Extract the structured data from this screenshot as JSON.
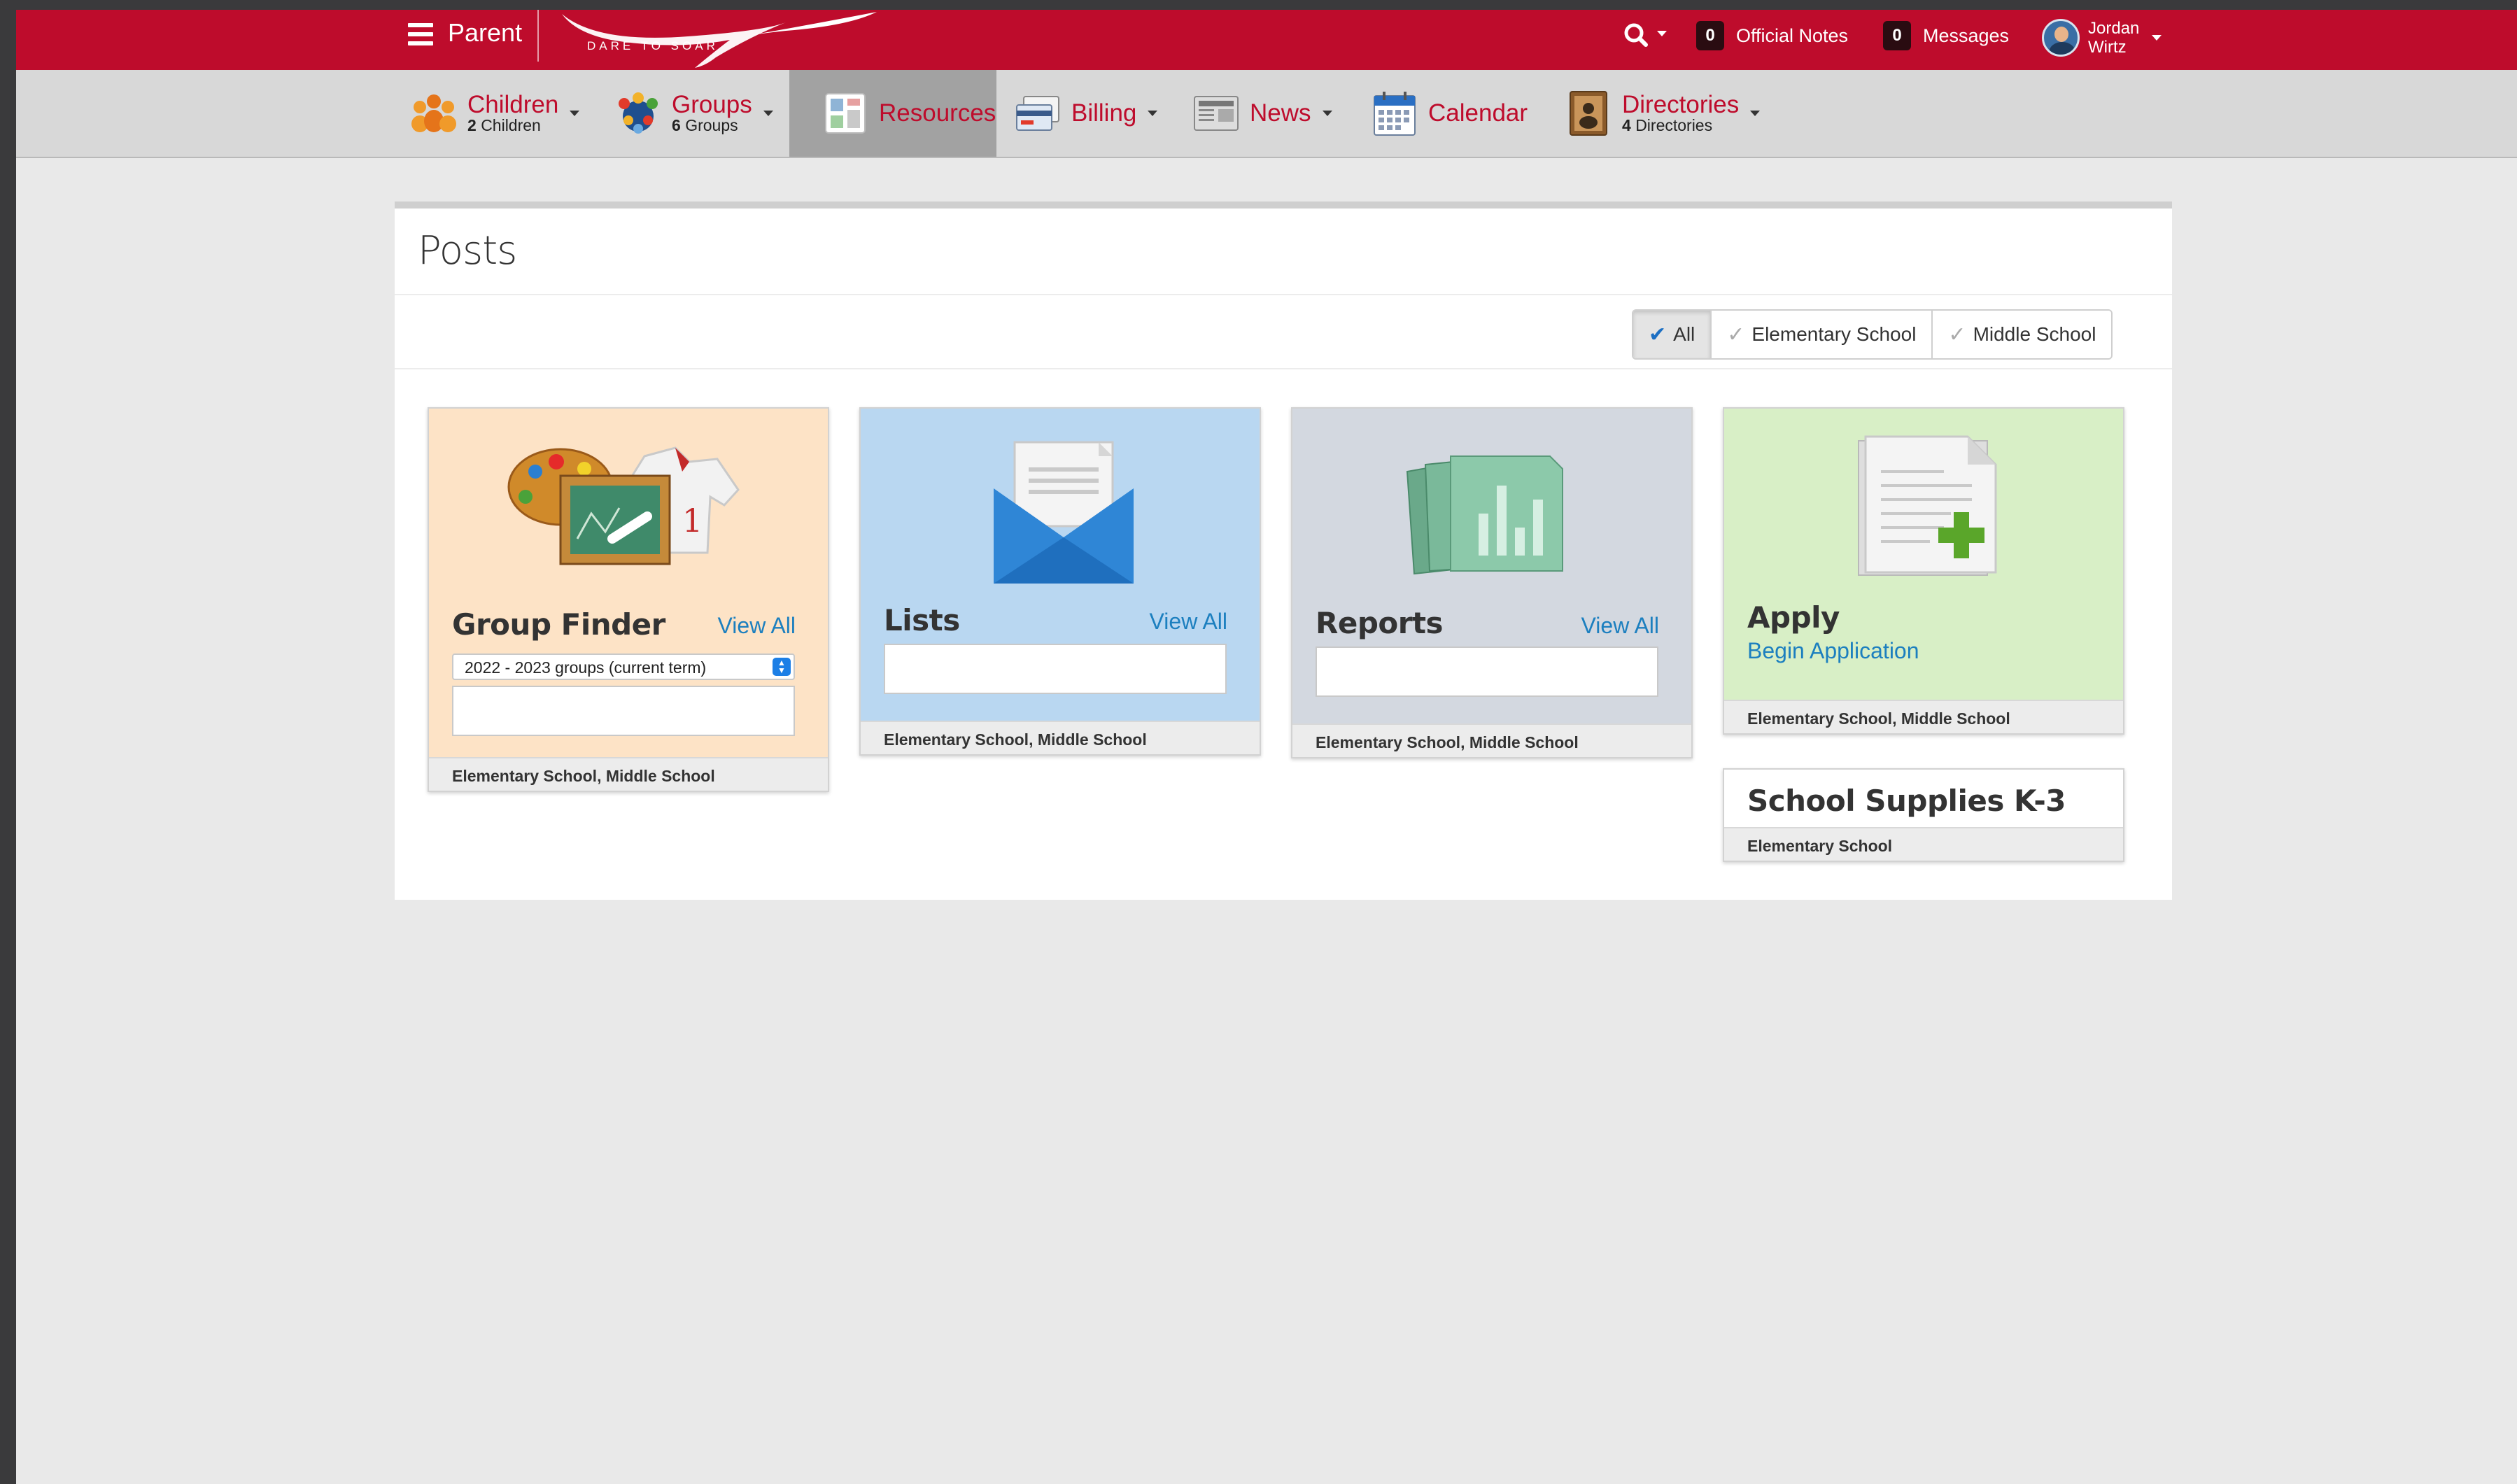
{
  "topbar": {
    "role": "Parent",
    "logo_text": "DARE TO SOAR",
    "official_notes": {
      "count": "0",
      "label": "Official Notes"
    },
    "messages": {
      "count": "0",
      "label": "Messages"
    },
    "user": {
      "first": "Jordan",
      "last": "Wirtz"
    },
    "color": "#be0c2c"
  },
  "nav": [
    {
      "label": "Children",
      "sub_count": "2",
      "sub_text": "Children",
      "icon": "children-icon"
    },
    {
      "label": "Groups",
      "sub_count": "6",
      "sub_text": "Groups",
      "icon": "groups-icon"
    },
    {
      "label": "Resources",
      "icon": "resources-icon",
      "active": true
    },
    {
      "label": "Billing",
      "icon": "billing-icon"
    },
    {
      "label": "News",
      "icon": "news-icon"
    },
    {
      "label": "Calendar",
      "icon": "calendar-icon"
    },
    {
      "label": "Directories",
      "sub_count": "4",
      "sub_text": "Directories",
      "icon": "directories-icon"
    }
  ],
  "panel": {
    "title": "Posts",
    "filters": [
      {
        "label": "All",
        "selected": true
      },
      {
        "label": "Elementary School",
        "selected": false
      },
      {
        "label": "Middle School",
        "selected": false
      }
    ]
  },
  "cards": {
    "group_finder": {
      "title": "Group Finder",
      "link": "View All",
      "select_value": "2022 - 2023 groups (current term)",
      "footer": "Elementary School, Middle School",
      "bg": "#fde3c6"
    },
    "lists": {
      "title": "Lists",
      "link": "View All",
      "footer": "Elementary School, Middle School",
      "bg": "#b9d7f1"
    },
    "reports": {
      "title": "Reports",
      "link": "View All",
      "footer": "Elementary School, Middle School",
      "bg": "#d3d8e0"
    },
    "apply": {
      "title": "Apply",
      "link": "Begin Application",
      "footer": "Elementary School, Middle School",
      "bg": "#d8efc6"
    },
    "supplies": {
      "title": "School Supplies K-3",
      "footer": "Elementary School"
    }
  }
}
